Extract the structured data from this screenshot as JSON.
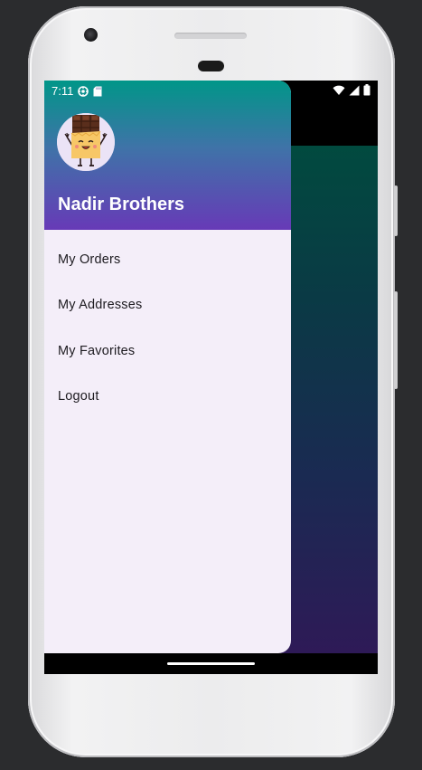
{
  "status_bar": {
    "time": "7:11",
    "left_icons": [
      "settings-icon",
      "sd-card-icon"
    ],
    "right_icons": [
      "wifi-icon",
      "signal-icon",
      "battery-icon"
    ]
  },
  "drawer": {
    "profile_name": "Nadir Brothers",
    "avatar_icon": "chocolate-character-avatar",
    "items": [
      {
        "label": "My Orders"
      },
      {
        "label": "My Addresses"
      },
      {
        "label": "My Favorites"
      },
      {
        "label": "Logout"
      }
    ]
  },
  "colors": {
    "header_gradient_start": "#009688",
    "header_gradient_end": "#673ab7",
    "drawer_background": "#f4eef9",
    "content_gradient_start": "#014a3f",
    "content_gradient_end": "#2e1a57"
  }
}
